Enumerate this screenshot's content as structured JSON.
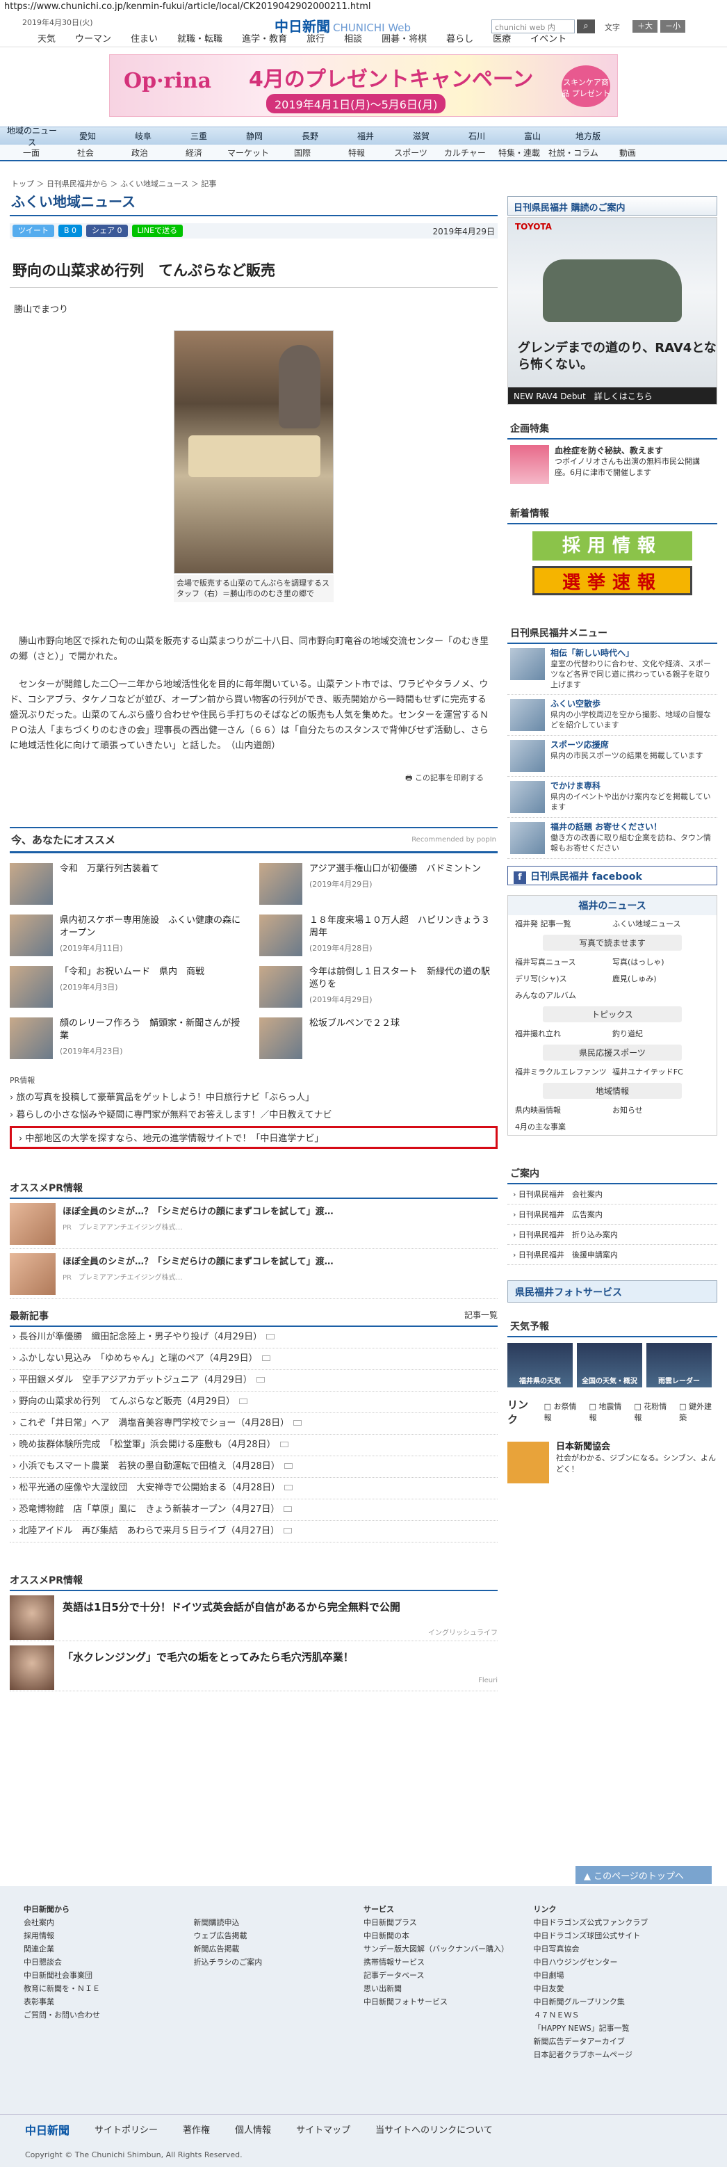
{
  "url": "https://www.chunichi.co.jp/kenmin-fukui/article/local/CK2019042902000211.html",
  "top": {
    "date": "2019年4月30日(火)",
    "logo": "中日新聞",
    "logo_sub": "CHUNICHI Web",
    "search_placeholder": "chunichi web 内",
    "font_label": "文字",
    "font_large": "＋大",
    "font_small": "－小"
  },
  "gnav": [
    "天気",
    "ウーマン",
    "住まい",
    "就職・転職",
    "進学・教育",
    "旅行",
    "相談",
    "囲碁・将棋",
    "暮らし",
    "医療",
    "イベント"
  ],
  "banner": {
    "brand": "Op·rina",
    "text": "4月のプレゼントキャンペーン",
    "dates": "2019年4月1日(月)～5月6日(月)",
    "badge": "スキンケア商品 プレゼント"
  },
  "rnav": [
    "地域のニュース",
    "愛知",
    "岐阜",
    "三重",
    "静岡",
    "長野",
    "福井",
    "滋賀",
    "石川",
    "富山",
    "地方版"
  ],
  "snav": [
    "一面",
    "社会",
    "政治",
    "経済",
    "マーケット",
    "国際",
    "特報",
    "スポーツ",
    "カルチャー",
    "特集・連載",
    "社説・コラム",
    "動画"
  ],
  "breadcrumb": "トップ ＞ 日刊県民福井から ＞ ふくい地域ニュース ＞ 記事",
  "section_title": "ふくい地域ニュース",
  "social": {
    "tweet": "ツイート",
    "b": "0",
    "share": "シェア 0",
    "line": "LINEで送る"
  },
  "article": {
    "date": "2019年4月29日",
    "title": "野向の山菜求め行列　てんぷらなど販売",
    "place": "勝山でまつり",
    "caption": "会場で販売する山菜のてんぷらを調理するスタッフ（右）＝勝山市ののむき里の郷で",
    "p1": "勝山市野向地区で採れた旬の山菜を販売する山菜まつりが二十八日、同市野向町竜谷の地域交流センター「のむき里の郷（さと）」で開かれた。",
    "p2": "センターが開館した二〇一二年から地域活性化を目的に毎年開いている。山菜テント市では、ワラビやタラノメ、ウド、コシアブラ、タケノコなどが並び、オープン前から買い物客の行列ができ、販売開始から一時間もせずに完売する盛況ぶりだった。山菜のてんぷら盛り合わせや住民ら手打ちのそばなどの販売も人気を集めた。センターを運営するＮＰＯ法人「まちづくりのむきの会」理事長の西出健一さん（６６）は「自分たちのスタンスで背伸びせず活動し、さらに地域活性化に向けて頑張っていきたい」と話した。　（山内道朗）",
    "print": "この記事を印刷する"
  },
  "reco": {
    "title": "今、あなたにオススメ",
    "powered": "Recommended by popIn",
    "items": [
      {
        "t": "令和　万葉行列古装着て",
        "d": ""
      },
      {
        "t": "アジア選手権山口が初優勝　バドミントン",
        "d": "(2019年4月29日)"
      },
      {
        "t": "県内初スケボー専用施設　ふくい健康の森にオープン",
        "d": "(2019年4月11日)"
      },
      {
        "t": "１８年度来場１０万人超　ハピリンきょう３周年",
        "d": "(2019年4月28日)"
      },
      {
        "t": "「令和」お祝いムード　県内　商戦",
        "d": "(2019年4月3日)"
      },
      {
        "t": "今年は前倒し１日スタート　新緑代の道の駅巡りを",
        "d": "(2019年4月29日)"
      },
      {
        "t": "顔のレリーフ作ろう　鯖頭家・新聞さんが授業",
        "d": "(2019年4月23日)"
      },
      {
        "t": "松坂ブルペンで２２球",
        "d": ""
      }
    ]
  },
  "pr": {
    "label": "PR情報",
    "links": [
      "旅の写真を投稿して豪華賞品をゲットしよう！中日旅行ナビ「ぶらっ人」",
      "暮らしの小さな悩みや疑問に専門家が無料でお答えします！／中日教えてナビ"
    ],
    "boxed": "中部地区の大学を探すなら、地元の進学情報サイトで！「中日進学ナビ」"
  },
  "pr_section": {
    "title": "オススメPR情報",
    "items": [
      {
        "t": "ほぼ全員のシミが…？「シミだらけの顔にまずコレを試して」渡…",
        "s": "PR　プレミアアンチエイジング株式…"
      },
      {
        "t": "ほぼ全員のシミが…？「シミだらけの顔にまずコレを試して」渡…",
        "s": "PR　プレミアアンチエイジング株式…"
      }
    ]
  },
  "latest": {
    "title": "最新記事",
    "more": "記事一覧",
    "items": [
      "長谷川が準優勝　織田記念陸上・男子やり投げ（4月29日）",
      "ふかしない見込み　「ゆめちゃん」と瑞のペア（4月29日）",
      "平田銀メダル　空手アジアカデットジュニア（4月29日）",
      "野向の山菜求め行列　てんぷらなど販売（4月29日）",
      "これぞ「井日常」へア　満塩音美容専門学校でショー（4月28日）",
      "晩め抜群体験所完成　「松堂軍」浜会開ける座敷も（4月28日）",
      "小浜でもスマート農業　若狭の墨自動運転で田植え（4月28日）",
      "松平光通の座像や大湿紋団　大安禅寺で公開始まる（4月28日）",
      "恐竜博物館　店「草原」風に　きょう新装オープン（4月27日）",
      "北陸アイドル　再び集結　あわらで来月５日ライブ（4月27日）"
    ]
  },
  "pr_section2": {
    "title": "オススメPR情報",
    "items": [
      {
        "t": "英語は1日5分で十分！ドイツ式英会話が自信があるから完全無料で公開",
        "s": "イングリッシュライフ"
      },
      {
        "t": "「水クレンジング」で毛穴の垢をとってみたら毛穴汚肌卒業！",
        "s": "Fleuri"
      }
    ]
  },
  "side": {
    "subscribe": "日刊県民福井 購読のご案内",
    "car_brand": "TOYOTA",
    "car_copy": "グレンデまでの道のり、RAV4となら怖くない。",
    "car_foot": "NEW RAV4 Debut　詳しくはこちら",
    "feature_title": "企画特集",
    "feature_item": {
      "t": "血栓症を防ぐ秘訣、教えます",
      "d": "つボイノリオさんも出演の無料市民公開講座。6月に津市で開催します"
    },
    "shinchaku": "新着情報",
    "recruit": "採用情報",
    "election": "選挙速報",
    "menu_title": "日刊県民福井メニュー",
    "menu": [
      {
        "t": "相伝「新しい時代へ」",
        "d": "皇室の代替わりに合わせ、文化や経済、スポーツなど各界で同じ道に携わっている親子を取り上げます"
      },
      {
        "t": "ふくい空散歩",
        "d": "県内の小学校周辺を空から撮影、地域の自慢などを紹介しています"
      },
      {
        "t": "スポーツ応援席",
        "d": "県内の市民スポーツの結果を掲載しています"
      },
      {
        "t": "でかけま専科",
        "d": "県内のイベントや出かけ案内などを掲載しています"
      },
      {
        "t": "福井の話題 お寄せください！",
        "d": "働き方の改善に取り組む企業を訪ね、タウン情報もお寄せください"
      }
    ],
    "facebook": "日刊県民福井 facebook",
    "fukui_news": "福井のニュース",
    "fn_row1": [
      "福井発 記事一覧",
      "ふくい地域ニュース"
    ],
    "photo_head": "写真で読ませます",
    "fn_row2": [
      "福井写真ニュース",
      "写真(はっしゃ)"
    ],
    "fn_row3": [
      "デリ写(シャ)ス",
      "鹿見(しゅみ)"
    ],
    "fn_row4": [
      "みんなのアルバム",
      ""
    ],
    "topics": "トピックス",
    "fn_row5": [
      "福井撮れ立れ",
      "釣り道紀"
    ],
    "sports": "県民応援スポーツ",
    "fn_row6": [
      "福井ミラクルエレファンツ",
      "福井ユナイテッドFC"
    ],
    "local_info": "地域情報",
    "fn_row7": [
      "県内映画情報",
      "お知らせ"
    ],
    "fn_row8": [
      "4月の主な事業",
      ""
    ],
    "guide_title": "ご案内",
    "guides": [
      "日刊県民福井　会社案内",
      "日刊県民福井　広告案内",
      "日刊県民福井　折り込み案内",
      "日刊県民福井　後援申請案内"
    ],
    "photoservice": "県民福井フォトサービス",
    "weather_title": "天気予報",
    "weather": [
      "福井県の天気",
      "全国の天気・概況",
      "雨雲レーダー"
    ],
    "links_title": "リンク",
    "links": [
      "お祭情報",
      "地震情報",
      "花粉情報",
      "鍵外建築"
    ],
    "nihon": {
      "t": "日本新聞協会",
      "d": "社会がわかる、ジブンになる。シンブン、よんどく！"
    }
  },
  "totop": "このページのトップへ",
  "footer": {
    "col1_title": "中日新聞から",
    "col1": [
      "会社案内",
      "採用情報",
      "関連企業",
      "中日懇談会",
      "中日新聞社会事業団",
      "教育に新聞を・ＮＩＥ",
      "表彰事業",
      "ご質問・お問い合わせ"
    ],
    "col2": [
      "新聞購読申込",
      "ウェブ広告掲載",
      "新聞広告掲載",
      "折込チラシのご案内"
    ],
    "col3_title": "サービス",
    "col3": [
      "中日新聞プラス",
      "中日新聞の本",
      "サンデー版大図解（バックナンバー購入）",
      "携帯情報サービス",
      "記事データベース",
      "思い出新聞",
      "中日新聞フォトサービス"
    ],
    "col4_title": "リンク",
    "col4": [
      "中日ドラゴンズ公式ファンクラブ",
      "中日ドラゴンズ球団公式サイト",
      "中日写真協会",
      "中日ハウジングセンター",
      "中日劇場",
      "中日友愛",
      "中日新聞グループリンク集",
      "４７ＮＥＷＳ",
      "「HAPPY NEWS」記事一覧",
      "新聞広告データアーカイブ",
      "日本記者クラブホームページ"
    ],
    "bar": [
      "中日新聞",
      "サイトポリシー",
      "著作権",
      "個人情報",
      "サイトマップ",
      "当サイトへのリンクについて"
    ],
    "copyright": "Copyright © The Chunichi Shimbun, All Rights Reserved."
  }
}
